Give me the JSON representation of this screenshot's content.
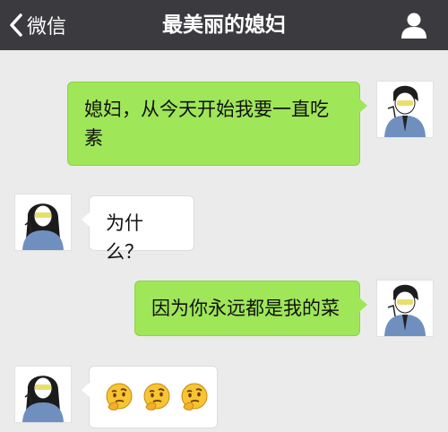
{
  "header": {
    "back_label": "微信",
    "title": "最美丽的媳妇",
    "back_icon": "chevron-left-icon",
    "profile_icon": "person-icon"
  },
  "messages": [
    {
      "side": "right",
      "text": "媳妇，从今天开始我要一直吃素"
    },
    {
      "side": "left",
      "text": "为什么？"
    },
    {
      "side": "right",
      "text": "因为你永远都是我的菜"
    },
    {
      "side": "left",
      "emoji": [
        "thinking-face-icon",
        "thinking-face-icon",
        "thinking-face-icon"
      ]
    }
  ],
  "colors": {
    "navbar": "#3b3a3f",
    "background": "#ebebeb",
    "sent_bubble": "#9fe658",
    "received_bubble": "#ffffff"
  }
}
